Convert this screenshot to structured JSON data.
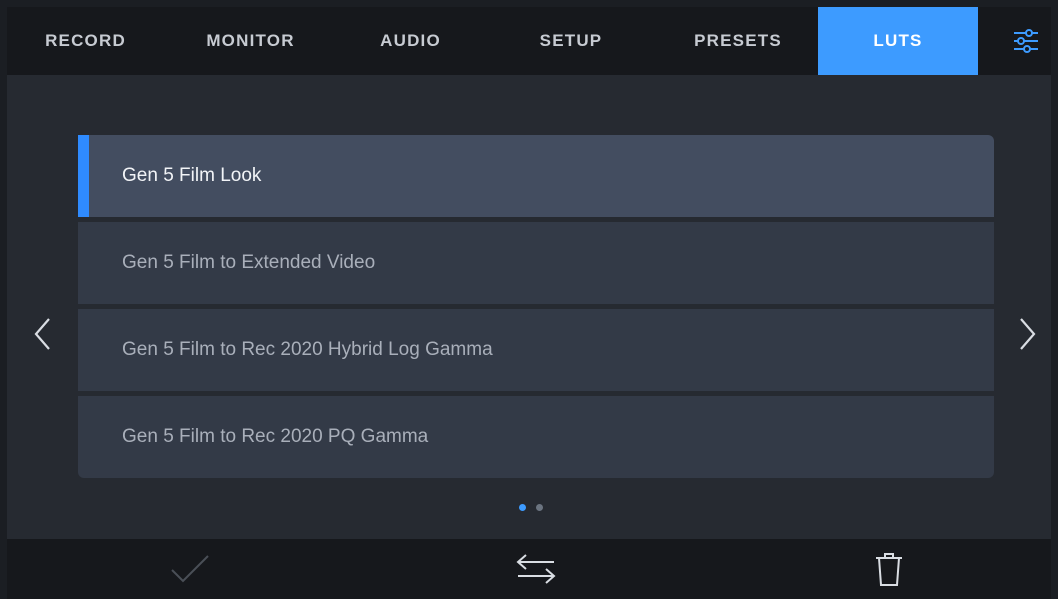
{
  "tabs": [
    {
      "label": "RECORD",
      "active": false
    },
    {
      "label": "MONITOR",
      "active": false
    },
    {
      "label": "AUDIO",
      "active": false
    },
    {
      "label": "SETUP",
      "active": false
    },
    {
      "label": "PRESETS",
      "active": false
    },
    {
      "label": "LUTS",
      "active": true
    }
  ],
  "menu_icon": "sliders-icon",
  "luts": [
    {
      "label": "Gen 5 Film Look",
      "selected": true
    },
    {
      "label": "Gen 5 Film to Extended Video",
      "selected": false
    },
    {
      "label": "Gen 5 Film to Rec 2020 Hybrid Log Gamma",
      "selected": false
    },
    {
      "label": "Gen 5 Film to Rec 2020 PQ Gamma",
      "selected": false
    }
  ],
  "pagination": {
    "pages": 2,
    "current": 1
  },
  "nav_icons": {
    "prev": "chevron-left-icon",
    "next": "chevron-right-icon"
  },
  "bottom_actions": [
    {
      "icon": "checkmark-icon",
      "enabled": false
    },
    {
      "icon": "swap-arrows-icon",
      "enabled": true
    },
    {
      "icon": "trash-icon",
      "enabled": true
    }
  ],
  "colors": {
    "accent": "#3d9bff",
    "selected_row": "#434d60",
    "row": "#333a47",
    "bar": "#16181c",
    "background": "#262a31"
  }
}
